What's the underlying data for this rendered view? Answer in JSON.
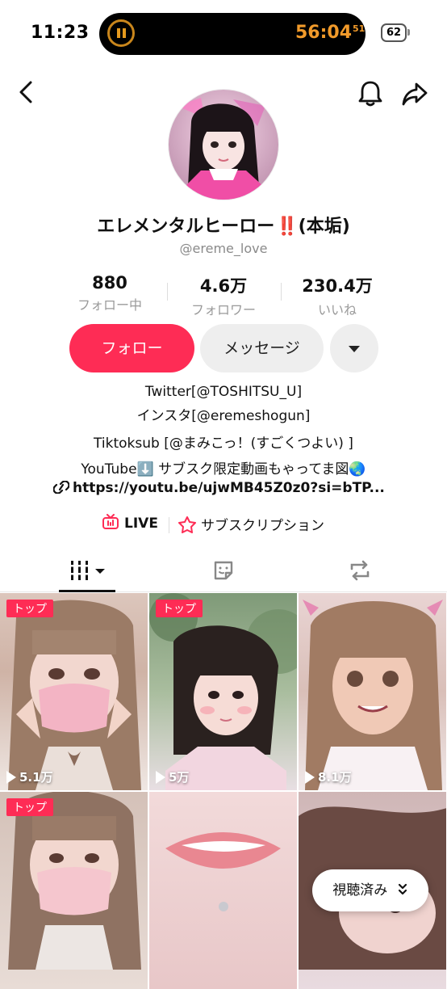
{
  "status_bar": {
    "time": "11:23",
    "timer": "56:04",
    "timer_sub": "51",
    "battery": "62"
  },
  "nav": {
    "back_icon": "chevron-left-icon",
    "bell_icon": "bell-icon",
    "share_icon": "share-arrow-icon"
  },
  "profile": {
    "display_name": "エレメンタルヒーロー",
    "display_name_emoji": "‼️",
    "display_name_suffix": "(本垢)",
    "username": "@ereme_love"
  },
  "stats": [
    {
      "value": "880",
      "label": "フォロー中"
    },
    {
      "value": "4.6万",
      "label": "フォロワー"
    },
    {
      "value": "230.4万",
      "label": "いいね"
    }
  ],
  "actions": {
    "follow": "フォロー",
    "message": "メッセージ"
  },
  "bio": {
    "line1": "Twitter[@TOSHITSU_U]",
    "line2": "インスタ[@eremeshogun]",
    "line3": "Tiktoksub [@まみこっ！(すごくつよい) ]",
    "line4": "YouTube⬇️  サブスク限定動画もゃってま図🌏",
    "link": "https://youtu.be/ujwMB45Z0z0?si=bTP..."
  },
  "badges_row": {
    "live": "LIVE",
    "subscription": "サブスクリプション"
  },
  "accent": "#fe2c55",
  "videos": [
    {
      "badge": "トップ",
      "views": "5.1万"
    },
    {
      "badge": "トップ",
      "views": "5万"
    },
    {
      "badge": "",
      "views": "8.1万"
    },
    {
      "badge": "トップ",
      "views": ""
    },
    {
      "badge": "",
      "views": ""
    },
    {
      "badge": "",
      "views": ""
    }
  ],
  "watched_label": "視聴済み"
}
